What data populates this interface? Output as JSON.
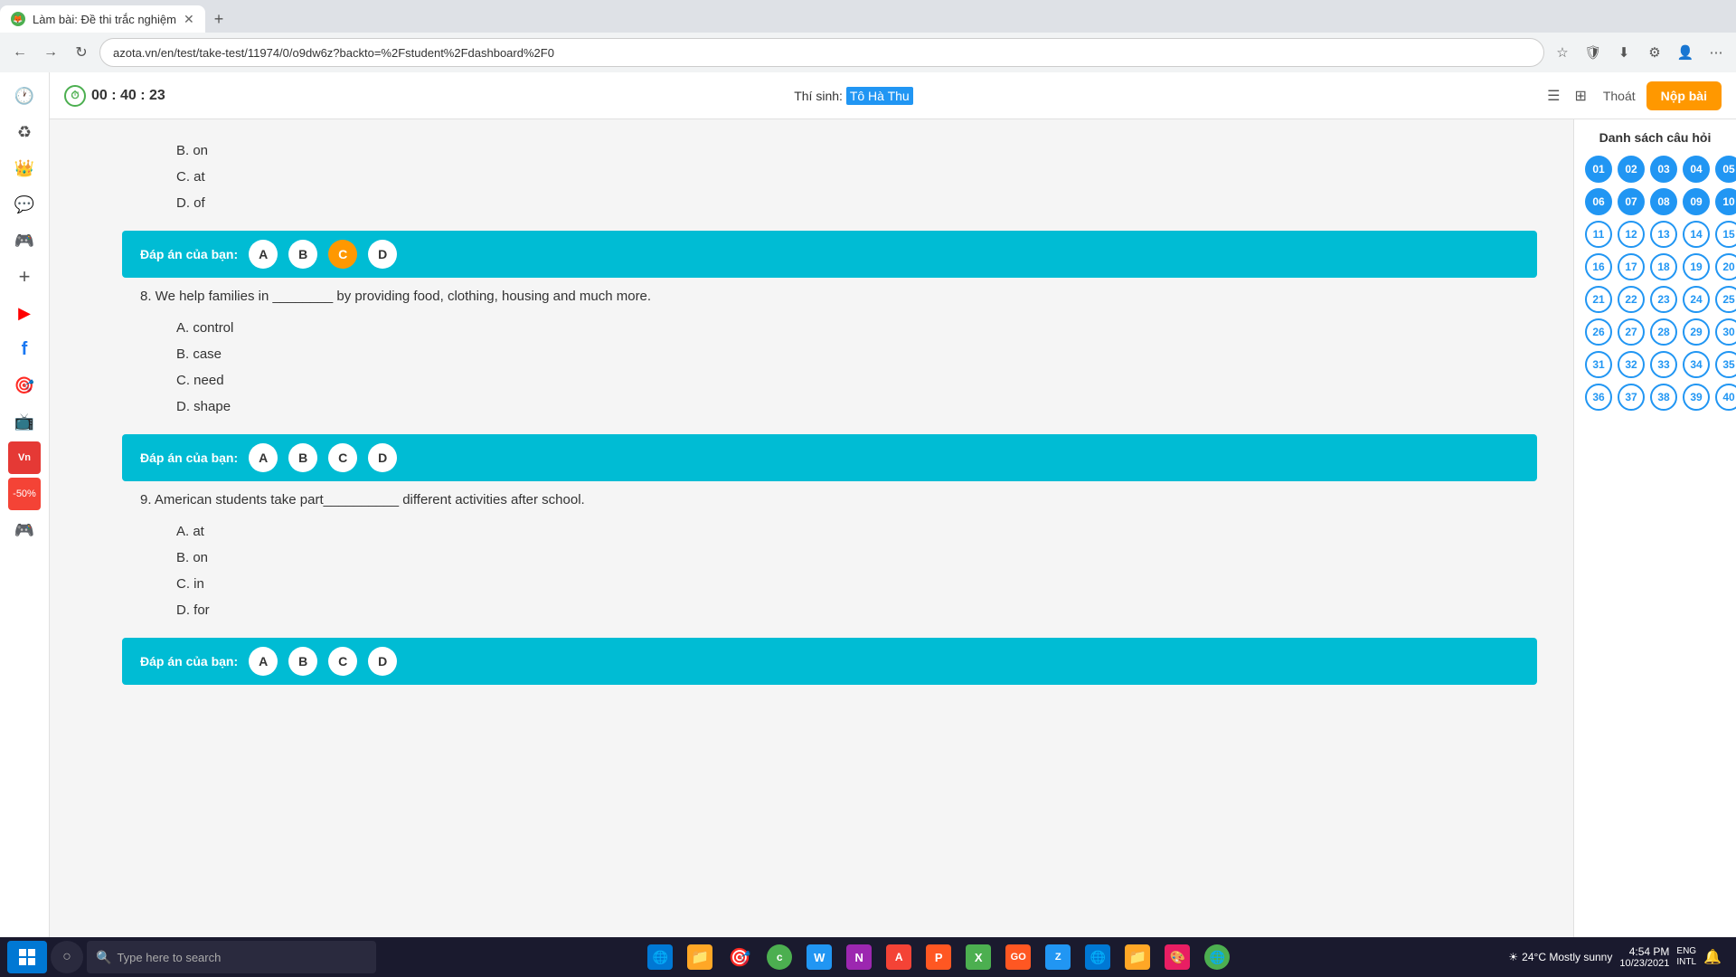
{
  "browser": {
    "tab_title": "Làm bài: Đề thi trắc nghiệm",
    "tab_new_label": "+",
    "address": "azota.vn/en/test/take-test/11974/0/o9dw6z?backto=%2Fstudent%2Fdashboard%2F0",
    "nav_back": "←",
    "nav_forward": "→",
    "nav_refresh": "↻"
  },
  "topbar": {
    "timer_label": "00 : 40 : 23",
    "student_label": "Thí sinh:",
    "student_name": "Tô Hà Thu",
    "view_list_icon": "☰",
    "view_grid_icon": "⊞",
    "logout_label": "Thoát",
    "submit_label": "Nộp bài"
  },
  "panel": {
    "title": "Danh sách câu hỏi",
    "questions": [
      {
        "num": "01",
        "state": "answered"
      },
      {
        "num": "02",
        "state": "answered"
      },
      {
        "num": "03",
        "state": "answered"
      },
      {
        "num": "04",
        "state": "answered"
      },
      {
        "num": "05",
        "state": "answered"
      },
      {
        "num": "06",
        "state": "answered"
      },
      {
        "num": "07",
        "state": "answered"
      },
      {
        "num": "08",
        "state": "answered"
      },
      {
        "num": "09",
        "state": "answered"
      },
      {
        "num": "10",
        "state": "answered"
      },
      {
        "num": "11",
        "state": "default"
      },
      {
        "num": "12",
        "state": "default"
      },
      {
        "num": "13",
        "state": "default"
      },
      {
        "num": "14",
        "state": "default"
      },
      {
        "num": "15",
        "state": "default"
      },
      {
        "num": "16",
        "state": "default"
      },
      {
        "num": "17",
        "state": "default"
      },
      {
        "num": "18",
        "state": "default"
      },
      {
        "num": "19",
        "state": "default"
      },
      {
        "num": "20",
        "state": "default"
      },
      {
        "num": "21",
        "state": "default"
      },
      {
        "num": "22",
        "state": "default"
      },
      {
        "num": "23",
        "state": "default"
      },
      {
        "num": "24",
        "state": "default"
      },
      {
        "num": "25",
        "state": "default"
      },
      {
        "num": "26",
        "state": "default"
      },
      {
        "num": "27",
        "state": "default"
      },
      {
        "num": "28",
        "state": "default"
      },
      {
        "num": "29",
        "state": "default"
      },
      {
        "num": "30",
        "state": "default"
      },
      {
        "num": "31",
        "state": "default"
      },
      {
        "num": "32",
        "state": "default"
      },
      {
        "num": "33",
        "state": "default"
      },
      {
        "num": "34",
        "state": "default"
      },
      {
        "num": "35",
        "state": "default"
      },
      {
        "num": "36",
        "state": "default"
      },
      {
        "num": "37",
        "state": "default"
      },
      {
        "num": "38",
        "state": "default"
      },
      {
        "num": "39",
        "state": "default"
      },
      {
        "num": "40",
        "state": "default"
      }
    ]
  },
  "quiz": {
    "q7_partial_b": "B. on",
    "q7_partial_c": "C. at",
    "q7_partial_d": "D. of",
    "q7_answer_label": "Đáp án của bạn:",
    "q7_options": [
      "A",
      "B",
      "C",
      "D"
    ],
    "q7_selected": "C",
    "q8_text": "8. We help families in ________ by providing food, clothing, housing and much more.",
    "q8_a": "A. control",
    "q8_b": "B. case",
    "q8_c": "C. need",
    "q8_d": "D. shape",
    "q8_answer_label": "Đáp án của bạn:",
    "q8_options": [
      "A",
      "B",
      "C",
      "D"
    ],
    "q9_text": "9. American students take part__________ different activities after school.",
    "q9_a": "A. at",
    "q9_b": "B. on",
    "q9_c": "C. in",
    "q9_d": "D. for",
    "q9_answer_label": "Đáp án của bạn:",
    "q9_options": [
      "A",
      "B",
      "C",
      "D"
    ]
  },
  "taskbar": {
    "search_placeholder": "Type here to search",
    "time": "4:54 PM",
    "date": "10/23/2021",
    "weather": "24°C  Mostly sunny",
    "lang": "ENG\nINTL"
  },
  "sidebar_icons": [
    "🕐",
    "♻",
    "👑",
    "💬",
    "🎮",
    "+",
    "▶",
    "📘",
    "🎯",
    "📺",
    "Vn",
    "💰",
    "🎮"
  ]
}
